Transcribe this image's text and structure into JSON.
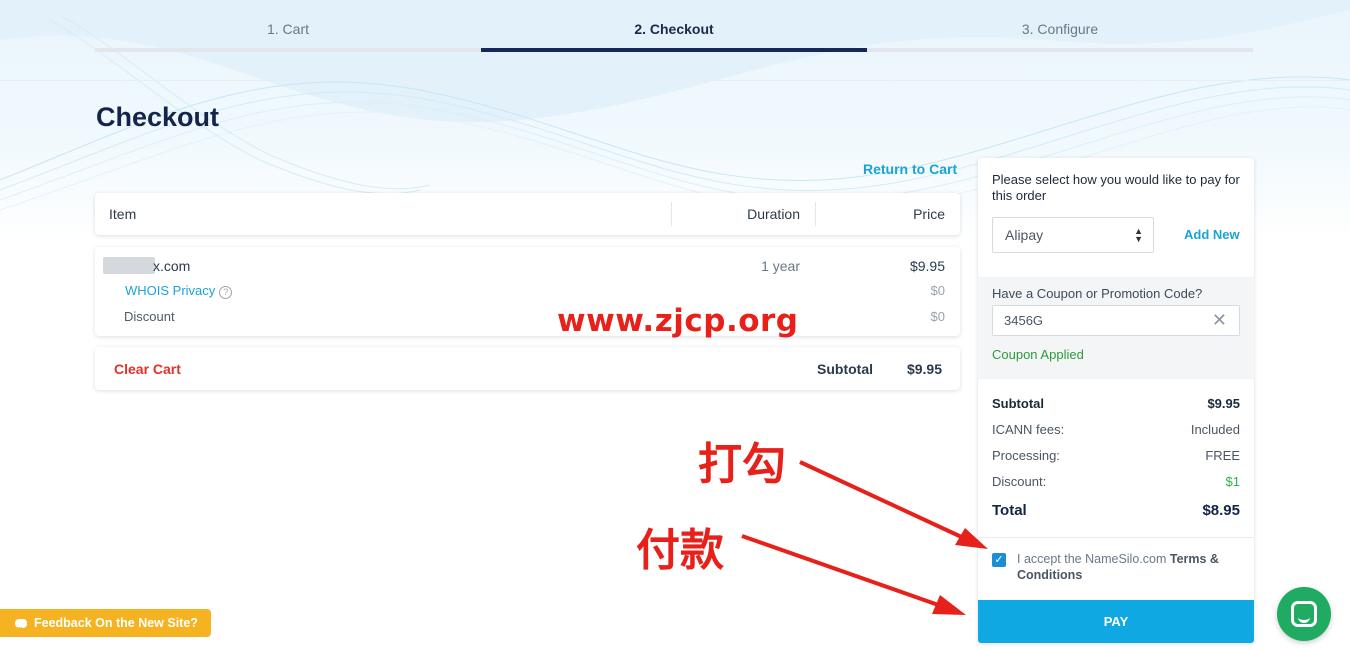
{
  "steps": [
    {
      "label": "1. Cart"
    },
    {
      "label": "2. Checkout"
    },
    {
      "label": "3. Configure"
    }
  ],
  "page_title": "Checkout",
  "return_link": "Return to Cart",
  "table": {
    "headers": {
      "item": "Item",
      "duration": "Duration",
      "price": "Price"
    },
    "domain": {
      "name": "x.com",
      "duration": "1 year",
      "price": "$9.95"
    },
    "whois": {
      "label": "WHOIS Privacy",
      "help": "?",
      "price": "$0"
    },
    "discount": {
      "label": "Discount",
      "price": "$0"
    }
  },
  "cart_footer": {
    "clear_label": "Clear Cart",
    "subtotal_label": "Subtotal",
    "subtotal_value": "$9.95"
  },
  "watermark": "www.zjcp.org",
  "payment": {
    "title": "Please select how you would like to pay for this order",
    "method_selected": "Alipay",
    "add_new": "Add New",
    "coupon_label": "Have a Coupon or Promotion Code?",
    "coupon_value": "3456G",
    "coupon_clear": "✕",
    "coupon_status": "Coupon Applied",
    "summary": {
      "subtotal_label": "Subtotal",
      "subtotal_value": "$9.95",
      "icann_label": "ICANN fees:",
      "icann_value": "Included",
      "processing_label": "Processing:",
      "processing_value": "FREE",
      "discount_label": "Discount:",
      "discount_value": "$1",
      "total_label": "Total",
      "total_value": "$8.95"
    },
    "terms_prefix": "I accept the NameSilo.com",
    "terms_link": "Terms & Conditions",
    "terms_checked": true,
    "pay_label": "PAY"
  },
  "annotations": {
    "check": "打勾",
    "pay": "付款"
  },
  "feedback_label": "Feedback On the New Site?",
  "colors": {
    "accent": "#1aa3d6",
    "pay_button": "#10a8e3",
    "danger": "#e0312b",
    "success": "#2d9a3a",
    "feedback": "#f5b321",
    "chat": "#1fab62",
    "annotation": "#e8201a"
  },
  "icons": {
    "help": "question-circle-icon",
    "clear": "close-icon",
    "check": "checkmark-icon",
    "chat": "chat-icon",
    "select": "select-arrows-icon"
  }
}
